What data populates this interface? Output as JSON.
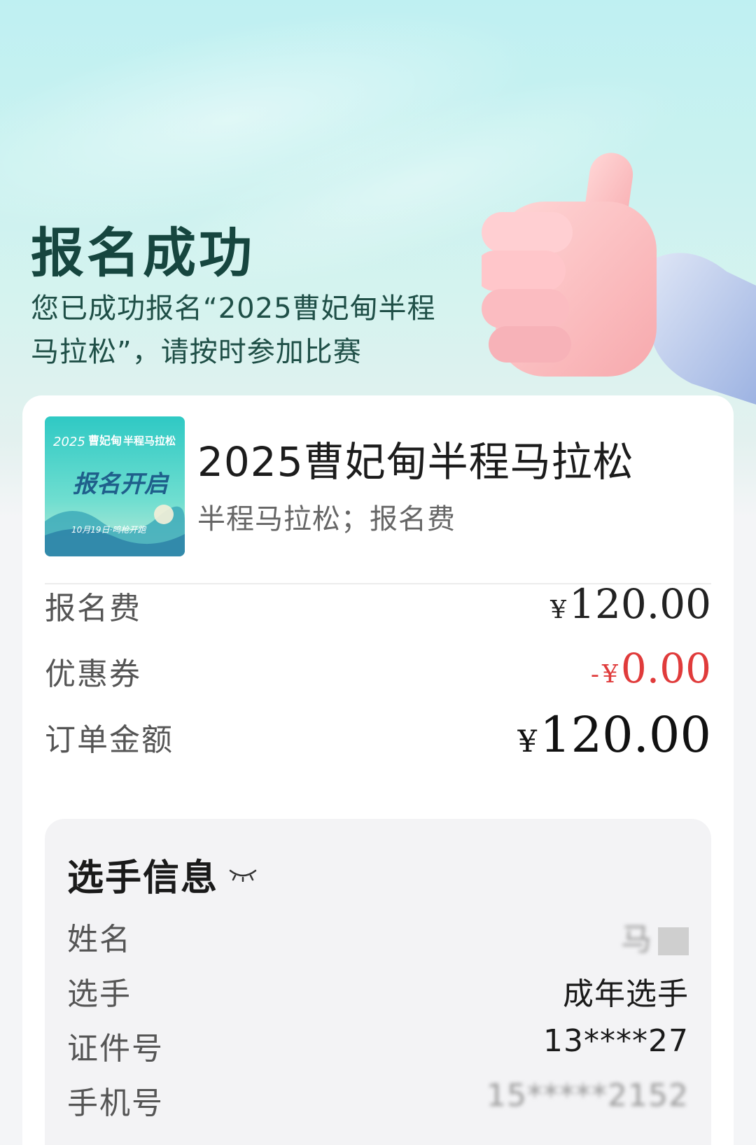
{
  "hero": {
    "title": "报名成功",
    "desc_line1": "您已成功报名“2025曹妃甸半程",
    "desc_line2": "马拉松”，请按时参加比赛"
  },
  "event": {
    "title": "2025曹妃甸半程马拉松",
    "subtitle": "半程马拉松；报名费",
    "poster": {
      "top_text": "2025",
      "brand": "曹妃甸",
      "name": "半程马拉松",
      "slogan": "报名开启",
      "date": "10月19日·鸣枪开跑"
    }
  },
  "fees": {
    "fee_label": "报名费",
    "fee_value": "120.00",
    "coupon_label": "优惠券",
    "coupon_value": "0.00",
    "total_label": "订单金额",
    "total_value": "120.00",
    "currency": "¥",
    "minus": "-"
  },
  "player": {
    "section_title": "选手信息",
    "name_label": "姓名",
    "name_value": "马",
    "type_label": "选手",
    "type_value": "成年选手",
    "id_label": "证件号",
    "id_value": "13****27",
    "phone_label": "手机号",
    "phone_value": "15*****2152"
  },
  "colors": {
    "title": "#16463f",
    "discount": "#e03b3b"
  },
  "icons": [
    "thumbs-up-icon",
    "eye-closed-icon"
  ]
}
